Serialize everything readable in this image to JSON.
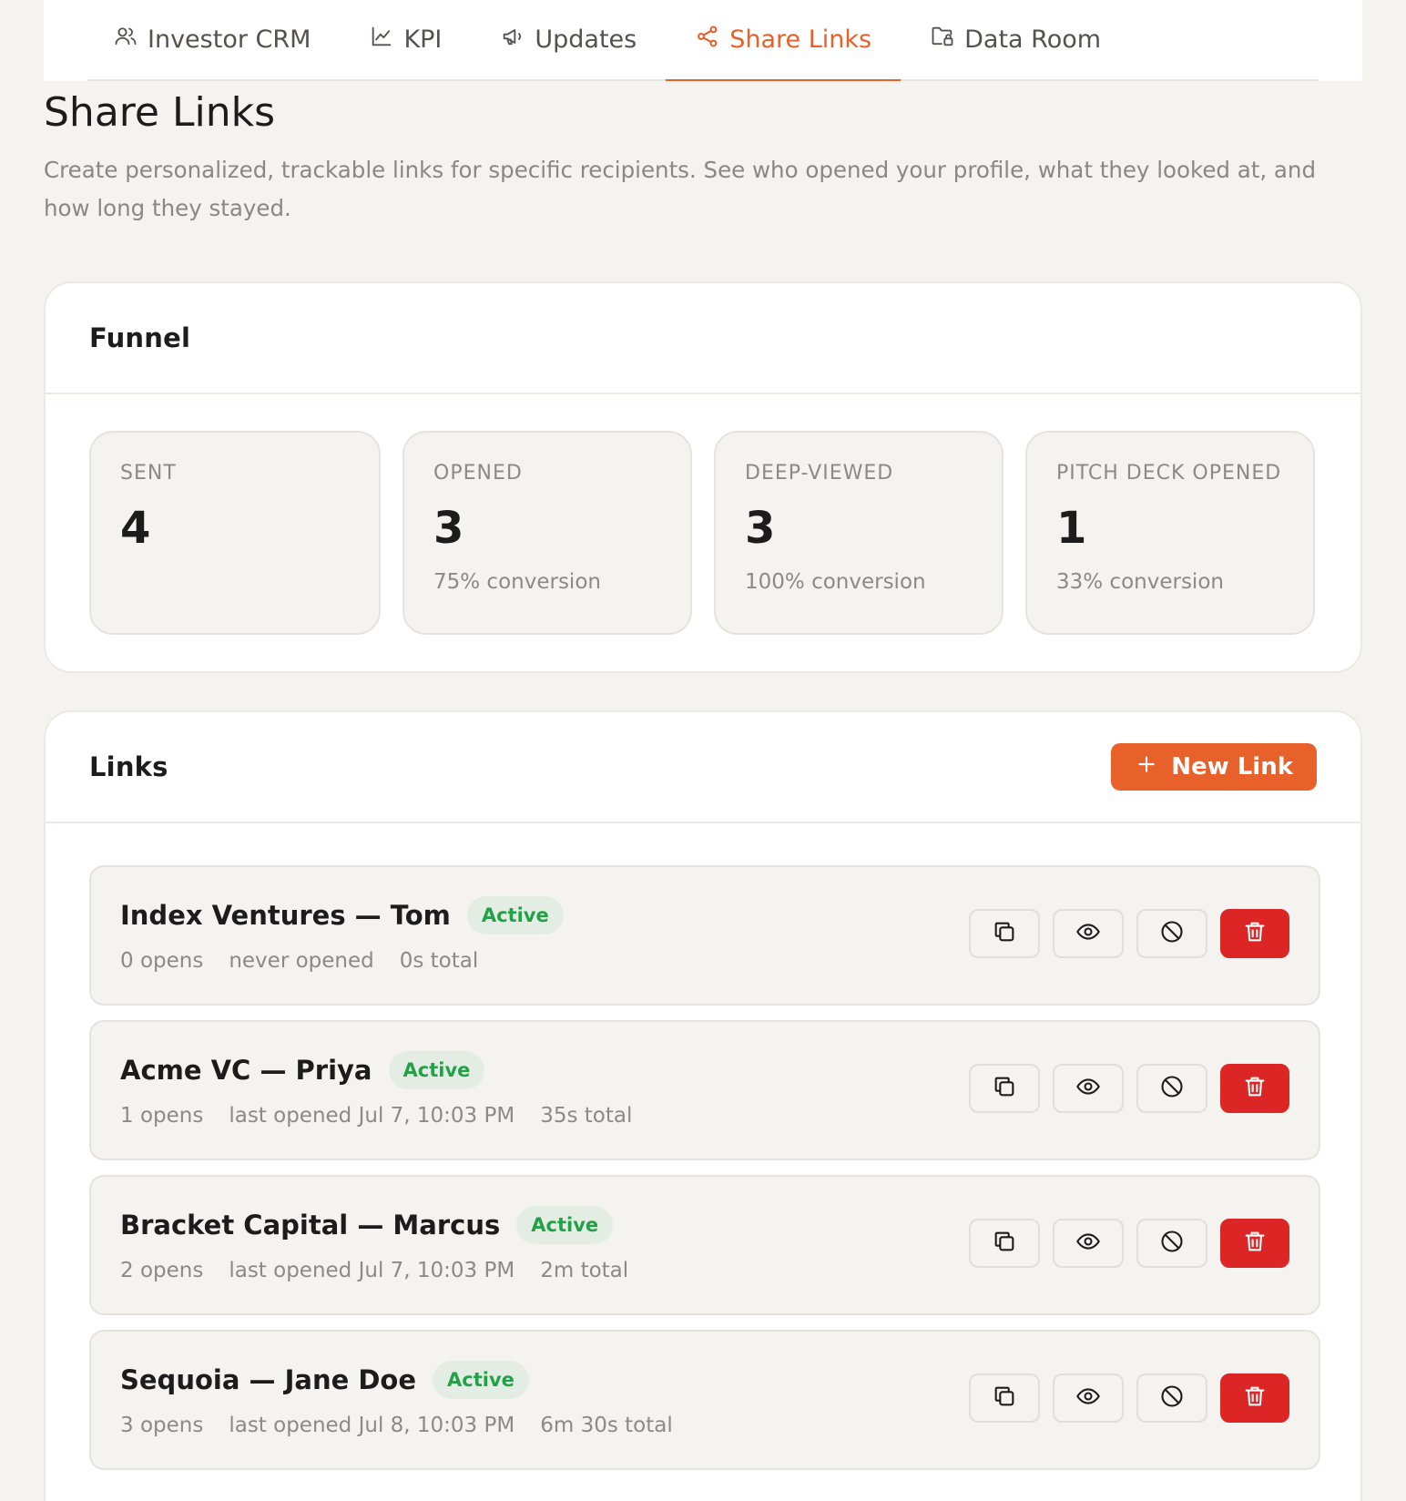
{
  "tabs": [
    {
      "label": "Investor CRM",
      "icon": "users-icon",
      "active": false
    },
    {
      "label": "KPI",
      "icon": "line-chart-icon",
      "active": false
    },
    {
      "label": "Updates",
      "icon": "megaphone-icon",
      "active": false
    },
    {
      "label": "Share Links",
      "icon": "share-icon",
      "active": true
    },
    {
      "label": "Data Room",
      "icon": "folder-lock-icon",
      "active": false
    }
  ],
  "page": {
    "title": "Share Links",
    "description": "Create personalized, trackable links for specific recipients. See who opened your profile, what they looked at, and how long they stayed."
  },
  "funnel": {
    "title": "Funnel",
    "stats": [
      {
        "label": "SENT",
        "value": "4",
        "sub": ""
      },
      {
        "label": "OPENED",
        "value": "3",
        "sub": "75% conversion"
      },
      {
        "label": "DEEP-VIEWED",
        "value": "3",
        "sub": "100% conversion"
      },
      {
        "label": "PITCH DECK OPENED",
        "value": "1",
        "sub": "33% conversion"
      }
    ]
  },
  "links": {
    "title": "Links",
    "new_link_label": "New Link",
    "items": [
      {
        "name": "Index Ventures — Tom",
        "status": "Active",
        "opens": "0 opens",
        "last": "never opened",
        "total": "0s total"
      },
      {
        "name": "Acme VC — Priya",
        "status": "Active",
        "opens": "1 opens",
        "last": "last opened Jul 7, 10:03 PM",
        "total": "35s total"
      },
      {
        "name": "Bracket Capital — Marcus",
        "status": "Active",
        "opens": "2 opens",
        "last": "last opened Jul 7, 10:03 PM",
        "total": "2m total"
      },
      {
        "name": "Sequoia — Jane Doe",
        "status": "Active",
        "opens": "3 opens",
        "last": "last opened Jul 8, 10:03 PM",
        "total": "6m 30s total"
      }
    ]
  },
  "colors": {
    "accent": "#e8612a",
    "danger": "#dc2626",
    "active_badge_text": "#24a148",
    "active_badge_bg": "#e4ede4"
  }
}
